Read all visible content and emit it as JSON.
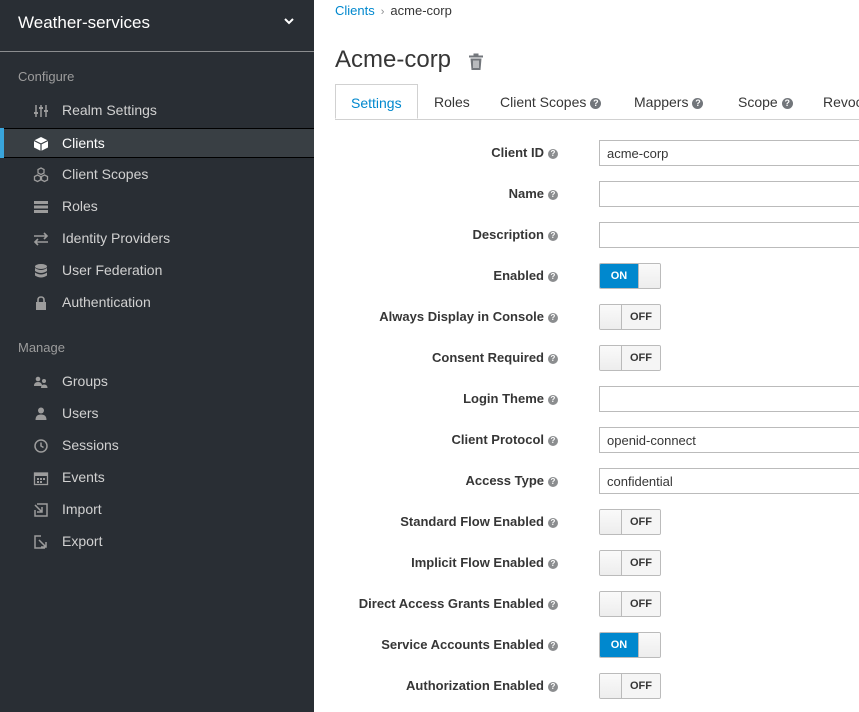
{
  "sidebar": {
    "realm": "Weather-services",
    "configure_label": "Configure",
    "manage_label": "Manage",
    "configure_items": [
      {
        "label": "Realm Settings",
        "icon": "sliders-icon"
      },
      {
        "label": "Clients",
        "icon": "cube-icon",
        "active": true
      },
      {
        "label": "Client Scopes",
        "icon": "cubes-icon"
      },
      {
        "label": "Roles",
        "icon": "list-icon"
      },
      {
        "label": "Identity Providers",
        "icon": "exchange-icon"
      },
      {
        "label": "User Federation",
        "icon": "database-icon"
      },
      {
        "label": "Authentication",
        "icon": "lock-icon"
      }
    ],
    "manage_items": [
      {
        "label": "Groups",
        "icon": "users-icon"
      },
      {
        "label": "Users",
        "icon": "user-icon"
      },
      {
        "label": "Sessions",
        "icon": "clock-icon"
      },
      {
        "label": "Events",
        "icon": "calendar-icon"
      },
      {
        "label": "Import",
        "icon": "import-icon"
      },
      {
        "label": "Export",
        "icon": "export-icon"
      }
    ]
  },
  "breadcrumb": {
    "parent": "Clients",
    "current": "acme-corp"
  },
  "page": {
    "title": "Acme-corp"
  },
  "tabs": [
    {
      "label": "Settings",
      "active": true,
      "help": false
    },
    {
      "label": "Roles",
      "help": false
    },
    {
      "label": "Client Scopes",
      "help": true
    },
    {
      "label": "Mappers",
      "help": true
    },
    {
      "label": "Scope",
      "help": true
    },
    {
      "label": "Revocation",
      "help": false
    }
  ],
  "form": {
    "client_id": {
      "label": "Client ID",
      "value": "acme-corp"
    },
    "name": {
      "label": "Name",
      "value": ""
    },
    "description": {
      "label": "Description",
      "value": ""
    },
    "enabled": {
      "label": "Enabled",
      "state": "ON"
    },
    "always_display": {
      "label": "Always Display in Console",
      "state": "OFF"
    },
    "consent_required": {
      "label": "Consent Required",
      "state": "OFF"
    },
    "login_theme": {
      "label": "Login Theme",
      "value": ""
    },
    "client_protocol": {
      "label": "Client Protocol",
      "value": "openid-connect"
    },
    "access_type": {
      "label": "Access Type",
      "value": "confidential"
    },
    "standard_flow": {
      "label": "Standard Flow Enabled",
      "state": "OFF"
    },
    "implicit_flow": {
      "label": "Implicit Flow Enabled",
      "state": "OFF"
    },
    "direct_access": {
      "label": "Direct Access Grants Enabled",
      "state": "OFF"
    },
    "service_accounts": {
      "label": "Service Accounts Enabled",
      "state": "ON"
    },
    "authorization": {
      "label": "Authorization Enabled",
      "state": "OFF"
    }
  },
  "colors": {
    "sidebar_bg": "#292e34",
    "accent": "#0088ce",
    "active_bar": "#39a5dc"
  }
}
